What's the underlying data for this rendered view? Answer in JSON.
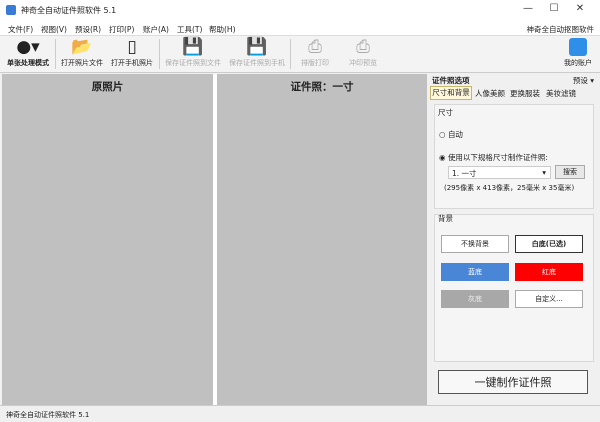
{
  "window": {
    "title": "神奇全自动证件照软件 5.1",
    "minimize": "—",
    "maximize": "☐",
    "close": "✕"
  },
  "menu": [
    "文件(F)",
    "视图(V)",
    "预设(R)",
    "打印(P)",
    "账户(A)",
    "工具(T)",
    "帮助(H)"
  ],
  "brand_link": "神奇全自动抠图软件",
  "toolbar": {
    "mode": "单张处理模式",
    "open_photo": "打开照片文件",
    "open_phone": "打开手机照片",
    "save_file": "保存证件照到文件",
    "save_phone": "保存证件照到手机",
    "layout_print": "排版打印",
    "print_preview": "冲印预览",
    "account": "我的账户"
  },
  "panels": {
    "original": "原照片",
    "result": "证件照：一寸"
  },
  "options": {
    "title": "证件照选项",
    "preset": "预设 ▾",
    "tabs": [
      "尺寸和背景",
      "人像美颜",
      "更换服装",
      "美妆滤镜"
    ],
    "size": {
      "label": "尺寸",
      "auto": "自动",
      "use_spec": "使用以下规格尺寸制作证件照:",
      "selected": "1. 一寸",
      "search": "搜索",
      "info": "(295像素 x 413像素，25毫米 x 35毫米)"
    },
    "background": {
      "label": "背景",
      "no_change": "不换背景",
      "white": "白底(已选)",
      "blue": "蓝底",
      "red": "红底",
      "gray": "灰底",
      "custom": "自定义..."
    },
    "make": "一键制作证件照"
  },
  "colors": {
    "blue": "#4a86d6",
    "red": "#ff0000",
    "gray": "#a8a8a8"
  },
  "status": "神奇全自动证件照软件 5.1"
}
